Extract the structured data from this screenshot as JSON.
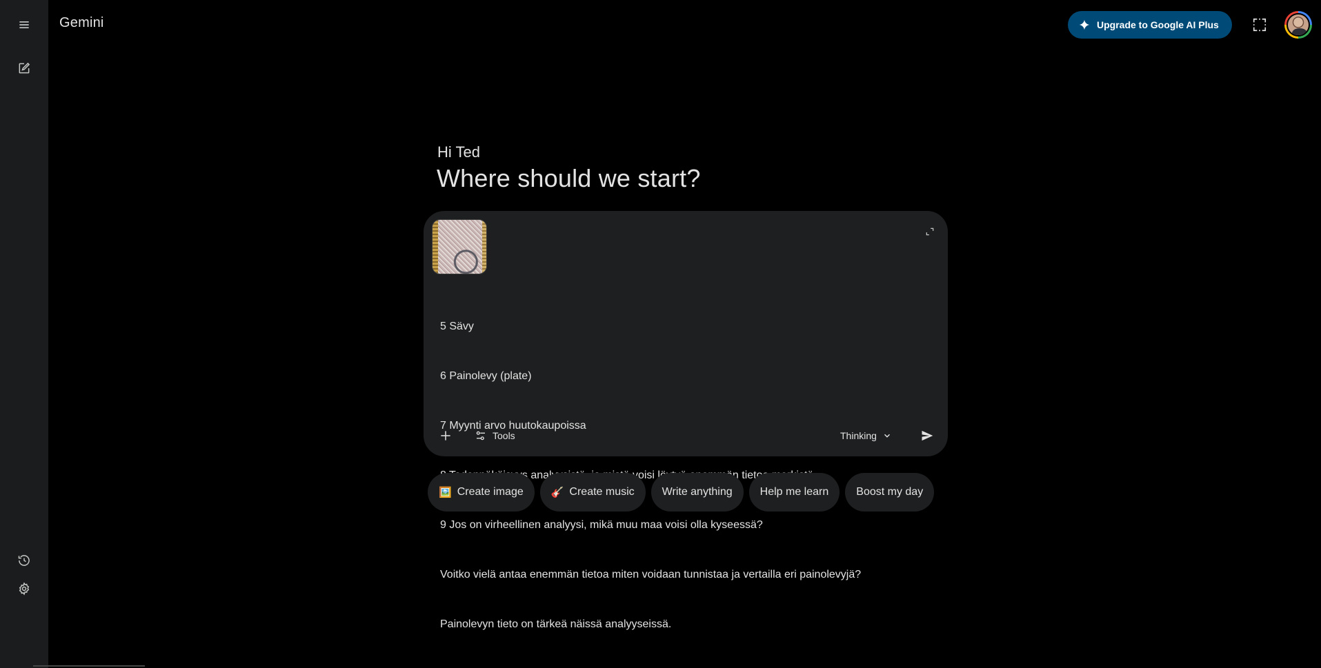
{
  "app": {
    "name": "Gemini"
  },
  "rail": {
    "menu_icon": "hamburger-menu-icon",
    "new_chat_icon": "edit-square-icon",
    "activity_icon": "history-icon",
    "settings_icon": "gear-icon"
  },
  "topbar": {
    "upgrade_label": "Upgrade to Google AI Plus",
    "upgrade_icon": "sparkle-icon",
    "upgrade_color": "#004a77",
    "screen_icon": "screenshot-frame-icon",
    "avatar": "user-avatar"
  },
  "greeting": {
    "small": "Hi Ted",
    "big": "Where should we start?"
  },
  "composer": {
    "attachment": "uploaded-stamp-image-thumbnail",
    "prompt_lines": [
      "5 Sävy",
      "6 Painolevy (plate)",
      "7 Myynti arvo huutokaupoissa",
      "8 Todennäköisyys analyysistä, ja mistä voisi löytyä enemmän tietoa merkistä",
      "9 Jos on virheellinen analyysi, mikä muu maa voisi olla kyseessä?",
      "Voitko vielä antaa enemmän tietoa miten voidaan tunnistaa ja vertailla eri painolevyjä?",
      "Painolevyn tieto on tärkeä näissä analyyseissä."
    ],
    "tools_label": "Tools",
    "model_label": "Thinking"
  },
  "chips": [
    {
      "emoji": "🖼️",
      "label": "Create image"
    },
    {
      "emoji": "🎸",
      "label": "Create music"
    },
    {
      "emoji": "",
      "label": "Write anything"
    },
    {
      "emoji": "",
      "label": "Help me learn"
    },
    {
      "emoji": "",
      "label": "Boost my day"
    }
  ]
}
